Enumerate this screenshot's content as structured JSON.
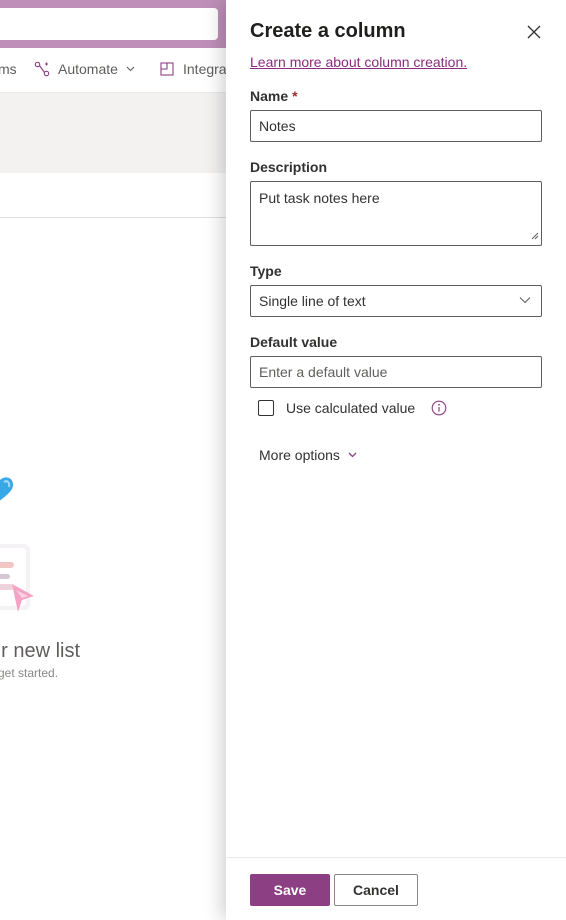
{
  "background": {
    "commands": [
      {
        "label": "ms",
        "icon": ""
      },
      {
        "label": "Automate",
        "icon": "automate-icon"
      },
      {
        "label": "Integra",
        "icon": "integrate-icon"
      }
    ],
    "empty_state": {
      "title": "ur new list",
      "subtitle": "o get started."
    }
  },
  "panel": {
    "title": "Create a column",
    "learn_link": "Learn more about column creation.",
    "name": {
      "label": "Name",
      "required_marker": "*",
      "value": "Notes"
    },
    "description": {
      "label": "Description",
      "value": "Put task notes here"
    },
    "type": {
      "label": "Type",
      "value": "Single line of text"
    },
    "default_value": {
      "label": "Default value",
      "placeholder": "Enter a default value"
    },
    "calculated": {
      "label": "Use calculated value",
      "checked": false
    },
    "more_options": "More options",
    "save_label": "Save",
    "cancel_label": "Cancel"
  },
  "colors": {
    "brand": "#8c3f82",
    "link": "#8c2b7f",
    "suite_bar": "#bf8fba"
  }
}
